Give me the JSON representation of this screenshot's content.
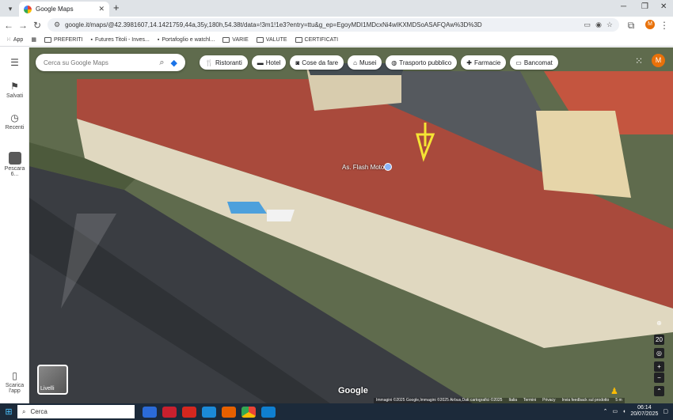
{
  "browser": {
    "tab_title": "Google Maps",
    "url": "google.it/maps/@42.3981607,14.1421759,44a,35y,180h,54.38t/data=!3m1!1e3?entry=ttu&g_ep=EgoyMDI1MDcxNi4wIKXMDSoASAFQAw%3D%3D",
    "bookmarks": [
      "App",
      "PREFERITI",
      "Futures Titoli - Inves...",
      "Portafoglio e watchl...",
      "VARIE",
      "VALUTE",
      "CERTIFICATI"
    ]
  },
  "sidebar": {
    "items": [
      {
        "label": "Salvati"
      },
      {
        "label": "Recenti"
      },
      {
        "label": "Pescara 6..."
      },
      {
        "label": "Scarica l'app"
      }
    ]
  },
  "search": {
    "placeholder": "Cerca su Google Maps"
  },
  "chips": [
    "Ristoranti",
    "Hotel",
    "Cose da fare",
    "Musei",
    "Trasporto pubblico",
    "Farmacie",
    "Bancomat"
  ],
  "account_initial": "M",
  "map": {
    "place_label": "As. Flash Motor",
    "layers_label": "Livelli",
    "google_logo": "Google",
    "attribution": [
      "Immagini ©2025 Google,Immagini ©2025 Airbus,Dati cartografici ©2025",
      "Italia",
      "Termini",
      "Privacy",
      "Invia feedback sul prodotto",
      "5 m"
    ],
    "tilt_value": "20"
  },
  "taskbar": {
    "search_label": "Cerca",
    "time": "06:14",
    "date": "20/07/2025"
  }
}
